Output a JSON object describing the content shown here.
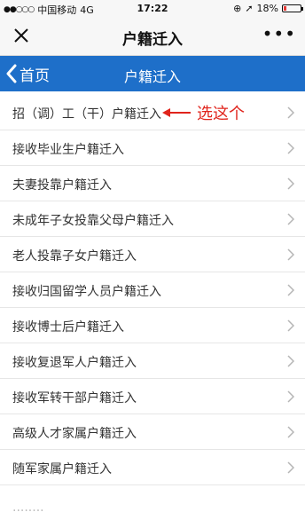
{
  "status_bar": {
    "carrier": "中国移动",
    "network": "4G",
    "time": "17:22",
    "battery_percent": "18%",
    "battery_level": 0.18,
    "battery_color": "#e53935"
  },
  "wechat_nav": {
    "title": "户籍迁入",
    "close_icon": "close-icon",
    "more_icon": "more-icon",
    "more_text": "•••"
  },
  "app_header": {
    "back_label": "首页",
    "title": "户籍迁入",
    "color": "#1e6fc9"
  },
  "annotation": {
    "text": "选这个",
    "color": "#e0241c"
  },
  "items": [
    {
      "label": "招（调）工（干）户籍迁入"
    },
    {
      "label": "接收毕业生户籍迁入"
    },
    {
      "label": "夫妻投靠户籍迁入"
    },
    {
      "label": "未成年子女投靠父母户籍迁入"
    },
    {
      "label": "老人投靠子女户籍迁入"
    },
    {
      "label": "接收归国留学人员户籍迁入"
    },
    {
      "label": "接收博士后户籍迁入"
    },
    {
      "label": "接收复退军人户籍迁入"
    },
    {
      "label": "接收军转干部户籍迁入"
    },
    {
      "label": "高级人才家属户籍迁入"
    },
    {
      "label": "随军家属户籍迁入"
    }
  ]
}
